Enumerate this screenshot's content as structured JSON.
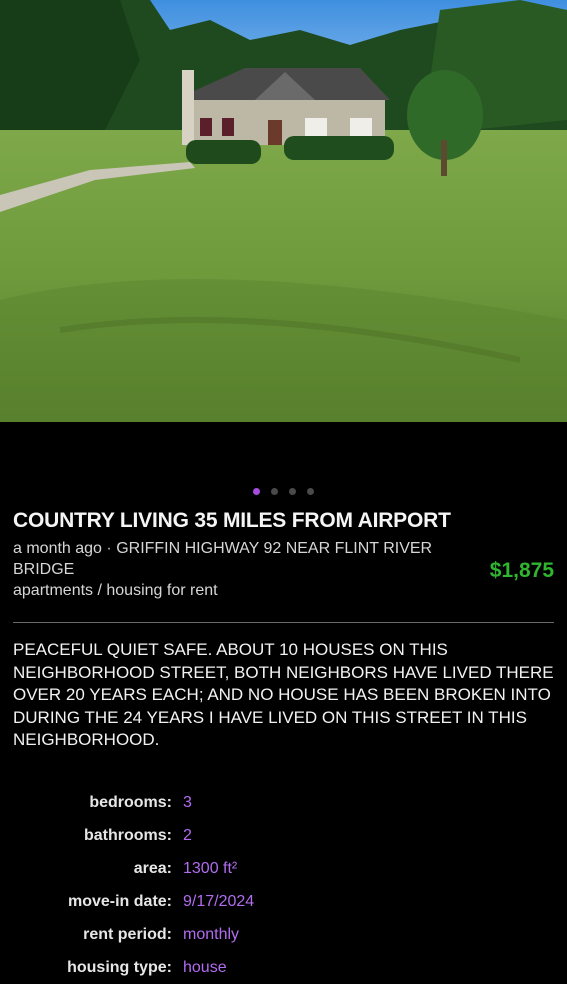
{
  "listing": {
    "title": "COUNTRY LIVING 35 MILES FROM AIRPORT",
    "posted": "a month ago",
    "separator": "·",
    "location": "GRIFFIN HIGHWAY 92 NEAR FLINT RIVER BRIDGE",
    "category": "apartments / housing for rent",
    "price": "$1,875",
    "description": "PEACEFUL QUIET SAFE. ABOUT 10 HOUSES ON THIS NEIGHBORHOOD STREET, BOTH NEIGHBORS HAVE LIVED THERE OVER 20 YEARS EACH; AND NO HOUSE HAS BEEN BROKEN INTO DURING THE 24 YEARS I HAVE LIVED ON THIS STREET IN THIS NEIGHBORHOOD."
  },
  "gallery": {
    "image_count": 4,
    "active_index": 0
  },
  "attributes": [
    {
      "label": "bedrooms:",
      "value": "3"
    },
    {
      "label": "bathrooms:",
      "value": "2"
    },
    {
      "label": "area:",
      "value": "1300 ft²"
    },
    {
      "label": "move-in date:",
      "value": "9/17/2024"
    },
    {
      "label": "rent period:",
      "value": "monthly"
    },
    {
      "label": "housing type:",
      "value": "house"
    }
  ],
  "colors": {
    "background": "#000000",
    "price": "#2fb52f",
    "attribute_value": "#b26cf0",
    "active_dot": "#a64ce0"
  }
}
